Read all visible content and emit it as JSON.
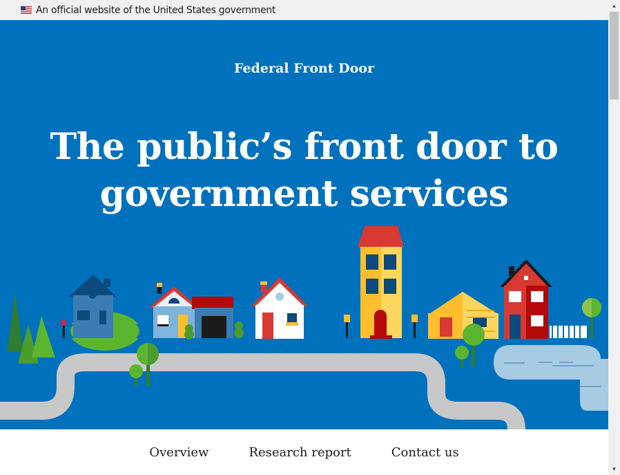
{
  "gov_banner": {
    "text": "An official website of the United States government",
    "flag_icon": "us-flag-icon"
  },
  "hero": {
    "site_name": "Federal Front Door",
    "headline_line1": "The public’s front door to",
    "headline_line2": "government services",
    "background_color": "#0071bc"
  },
  "nav": {
    "items": [
      {
        "label": "Overview"
      },
      {
        "label": "Research report"
      },
      {
        "label": "Contact us"
      }
    ]
  },
  "scrollbar": {
    "up_icon": "▲",
    "down_icon": "▼"
  }
}
